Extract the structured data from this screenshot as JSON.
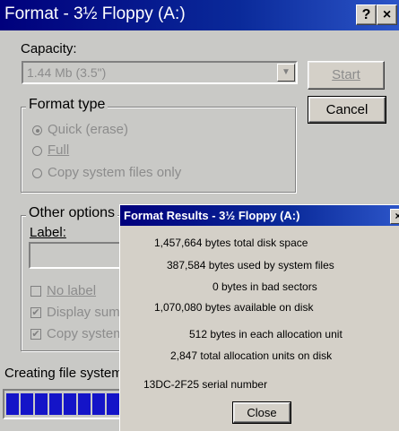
{
  "window": {
    "title": "Format - 3½ Floppy (A:)",
    "help_label": "?",
    "close_label": "×"
  },
  "capacity": {
    "label": "Capacity:",
    "value": "1.44 Mb (3.5\")"
  },
  "buttons": {
    "start": "Start",
    "cancel": "Cancel"
  },
  "format_type": {
    "title": "Format type",
    "options": [
      "Quick (erase)",
      "Full",
      "Copy system files only"
    ],
    "selected": "Quick (erase)"
  },
  "other_options": {
    "title": "Other options",
    "label_caption": "Label:",
    "label_value": "",
    "no_label": "No label",
    "display_summary": "Display summ",
    "copy_system": "Copy system f"
  },
  "status": {
    "text": "Creating file system",
    "progress_segments": 8
  },
  "results": {
    "title": "Format Results - 3½ Floppy (A:)",
    "close_label": "×",
    "lines": [
      "1,457,664 bytes total disk space",
      "387,584 bytes used by system files",
      "0 bytes in bad sectors",
      "1,070,080 bytes available on disk",
      "512 bytes in each allocation unit",
      "2,847 total allocation units on disk",
      "13DC-2F25 serial number"
    ],
    "close_button": "Close"
  },
  "colors": {
    "titlebar": "#00007c",
    "progress": "#1414c8",
    "face": "#c9c9c6"
  }
}
